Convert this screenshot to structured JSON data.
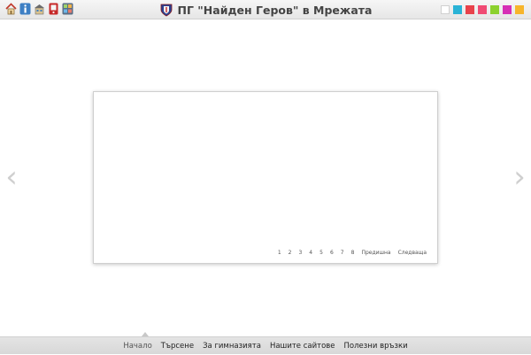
{
  "header": {
    "title": "ПГ \"Найден Геров\" в Мрежата",
    "icons": [
      "home-icon",
      "info-icon",
      "school-icon",
      "phone-icon",
      "gallery-icon"
    ],
    "swatches": [
      {
        "name": "white",
        "color": "#ffffff"
      },
      {
        "name": "cyan",
        "color": "#2ab3d6"
      },
      {
        "name": "red",
        "color": "#e8424b"
      },
      {
        "name": "pink",
        "color": "#f04a73"
      },
      {
        "name": "green",
        "color": "#8cd12e"
      },
      {
        "name": "magenta",
        "color": "#d62fb6"
      },
      {
        "name": "yellow",
        "color": "#f7b52b"
      }
    ]
  },
  "nav": {
    "prev_symbol": "‹",
    "next_symbol": "›"
  },
  "pager": {
    "pages": [
      "1",
      "2",
      "3",
      "4",
      "5",
      "6",
      "7",
      "8"
    ],
    "prev_label": "Предишна",
    "next_label": "Следваща"
  },
  "bottom_nav": {
    "items": [
      "Начало",
      "Търсене",
      "За гимназията",
      "Нашите сайтове",
      "Полезни връзки"
    ],
    "active_index": 0
  }
}
